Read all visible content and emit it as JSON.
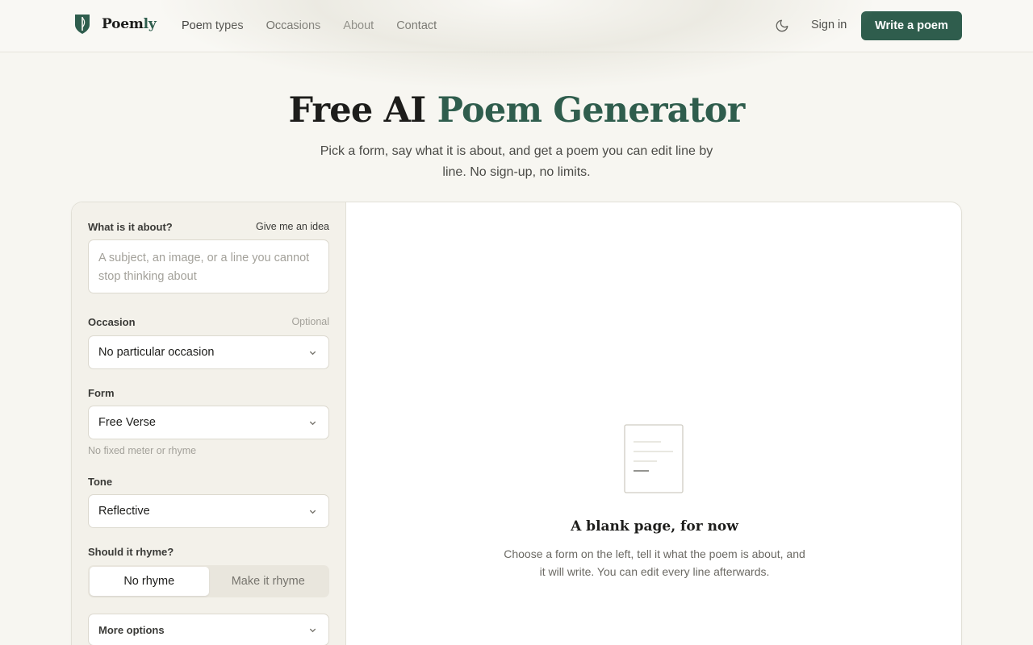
{
  "header": {
    "logo_text_main": "Poem",
    "logo_text_accent": "ly",
    "nav": [
      "Poem types",
      "Occasions",
      "About",
      "Contact"
    ],
    "signin": "Sign in",
    "cta": "Write a poem"
  },
  "hero": {
    "title_plain": "Free AI ",
    "title_accent": "Poem Generator",
    "subtitle": "Pick a form, say what it is about, and get a poem you can edit line by line. No sign-up, no limits."
  },
  "form": {
    "about_label": "What is it about?",
    "idea_link": "Give me an idea",
    "about_placeholder": "A subject, an image, or a line you cannot stop thinking about",
    "occasion_label": "Occasion",
    "occasion_optional": "Optional",
    "occasion_value": "No particular occasion",
    "form_label": "Form",
    "form_value": "Free Verse",
    "form_hint": "No fixed meter or rhyme",
    "tone_label": "Tone",
    "tone_value": "Reflective",
    "rhyme_label": "Should it rhyme?",
    "rhyme_options": [
      "No rhyme",
      "Make it rhyme"
    ],
    "rhyme_selected": "No rhyme",
    "more_options": "More options"
  },
  "empty_state": {
    "title": "A blank page, for now",
    "text": "Choose a form on the left, tell it what the poem is about, and it will write. You can edit every line afterwards."
  },
  "colors": {
    "accent": "#2f5d4d",
    "background": "#f7f6f1"
  }
}
